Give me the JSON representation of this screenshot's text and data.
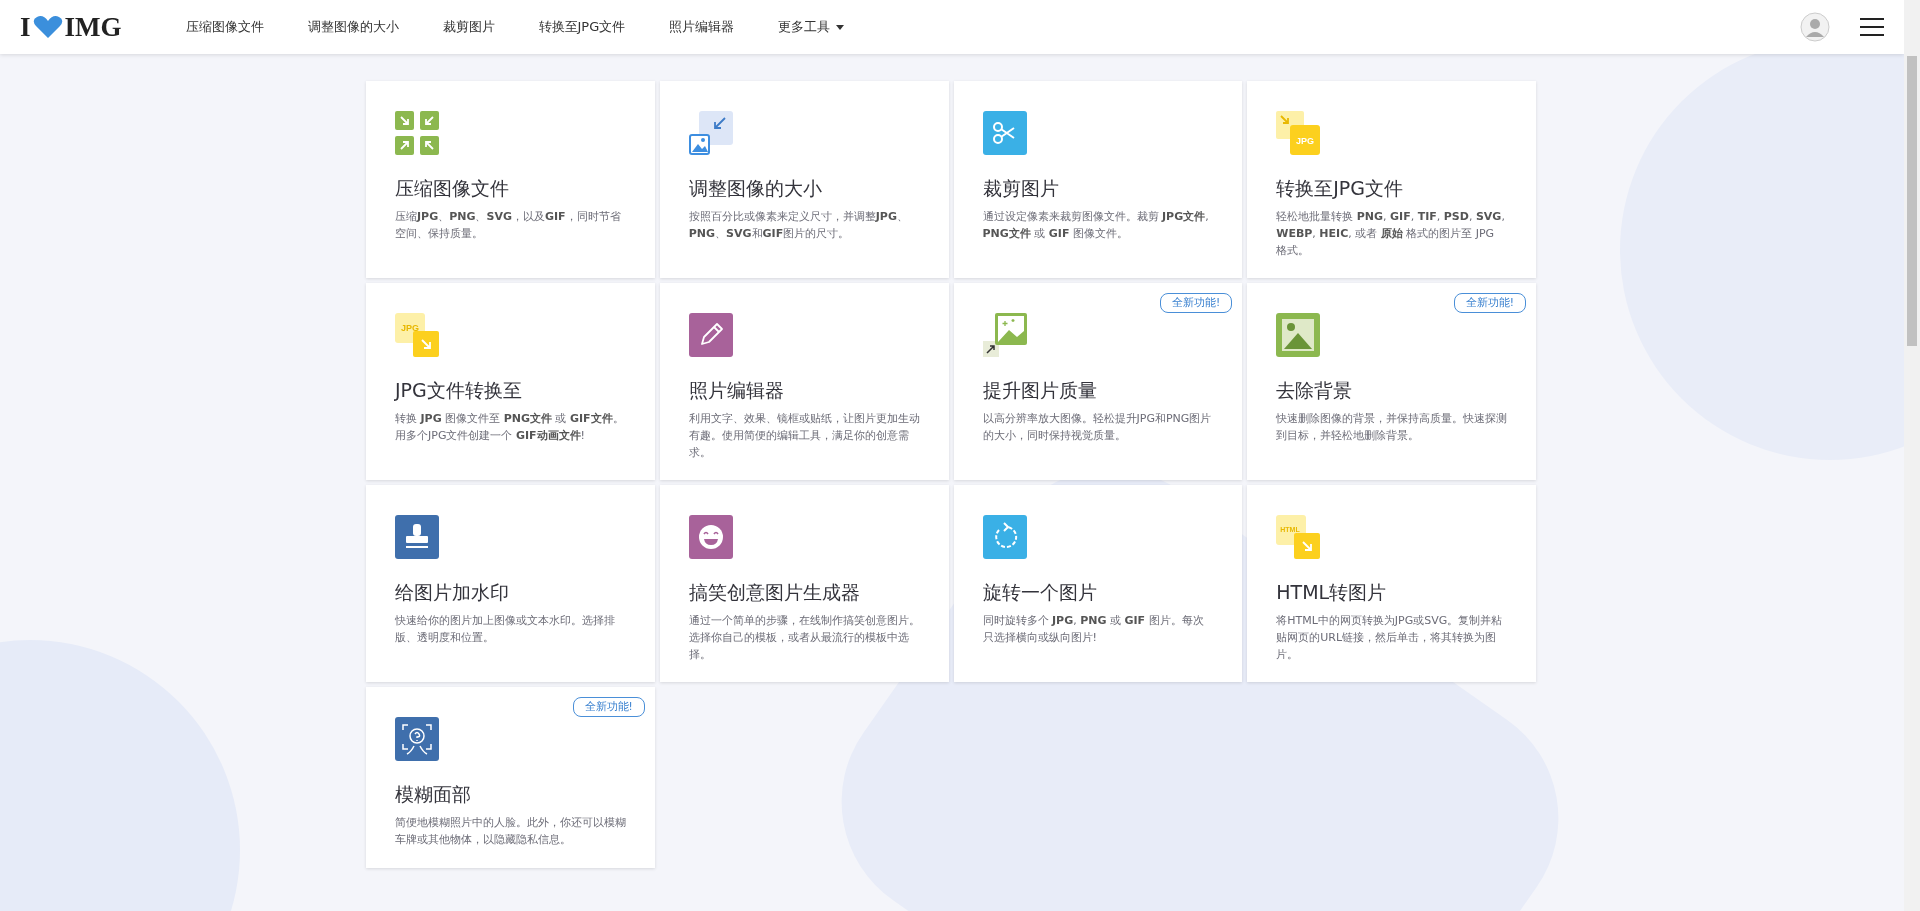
{
  "header": {
    "logo": {
      "left": "I",
      "right": "IMG"
    },
    "nav": [
      {
        "label": "压缩图像文件",
        "dropdown": false
      },
      {
        "label": "调整图像的大小",
        "dropdown": false
      },
      {
        "label": "裁剪图片",
        "dropdown": false
      },
      {
        "label": "转换至JPG文件",
        "dropdown": false
      },
      {
        "label": "照片编辑器",
        "dropdown": false
      },
      {
        "label": "更多工具",
        "dropdown": true
      }
    ]
  },
  "tools": [
    {
      "kind": "compress",
      "title": "压缩图像文件",
      "description": "压缩**JPG**、**PNG**、**SVG**，以及**GIF**，同时节省空间、保持质量。"
    },
    {
      "kind": "resize",
      "title": "调整图像的大小",
      "description": "按照百分比或像素来定义尺寸，并调整**JPG**、**PNG**、**SVG**和**GIF**图片的尺寸。"
    },
    {
      "kind": "crop",
      "title": "裁剪图片",
      "description": "通过设定像素来裁剪图像文件。裁剪 **JPG文件**, **PNG文件** 或 **GIF** 图像文件。"
    },
    {
      "kind": "to-jpg",
      "icon_text": "JPG",
      "title": "转换至JPG文件",
      "description": "轻松地批量转换 **PNG**, **GIF**, **TIF**, **PSD**, **SVG**, **WEBP**, **HEIC**, 或者 **原始** 格式的图片至 JPG 格式。"
    },
    {
      "kind": "from-jpg",
      "icon_text": "JPG",
      "title": "JPG文件转换至",
      "description": "转换 **JPG** 图像文件至 **PNG文件** 或 **GIF文件**。用多个JPG文件创建一个 **GIF动画文件**!"
    },
    {
      "kind": "edit",
      "title": "照片编辑器",
      "description": "利用文字、效果、镜框或贴纸，让图片更加生动有趣。使用简便的编辑工具，满足你的创意需求。"
    },
    {
      "kind": "upscale",
      "badge": "全新功能!",
      "title": "提升图片质量",
      "description": "以高分辨率放大图像。轻松提升JPG和PNG图片的大小，同时保持视觉质量。"
    },
    {
      "kind": "remove-bg",
      "badge": "全新功能!",
      "title": "去除背景",
      "description": "快速删除图像的背景，并保持高质量。快速探测到目标，并轻松地删除背景。"
    },
    {
      "kind": "watermark",
      "title": "给图片加水印",
      "description": "快速给你的图片加上图像或文本水印。选择排版、透明度和位置。"
    },
    {
      "kind": "meme",
      "title": "搞笑创意图片生成器",
      "description": "通过一个简单的步骤，在线制作搞笑创意图片。选择你自己的模板，或者从最流行的模板中选择。"
    },
    {
      "kind": "rotate",
      "title": "旋转一个图片",
      "description": "同时旋转多个 **JPG**, **PNG** 或 **GIF** 图片。每次只选择横向或纵向图片!"
    },
    {
      "kind": "html",
      "icon_text": "HTML",
      "title": "HTML转图片",
      "description": "将HTML中的网页转换为JPG或SVG。复制并粘贴网页的URL链接，然后单击，将其转换为图片。"
    },
    {
      "kind": "blur-face",
      "badge": "全新功能!",
      "title": "模糊面部",
      "description": "简便地模糊照片中的人脸。此外，你还可以模糊车牌或其他物体，以隐藏隐私信息。"
    }
  ]
}
